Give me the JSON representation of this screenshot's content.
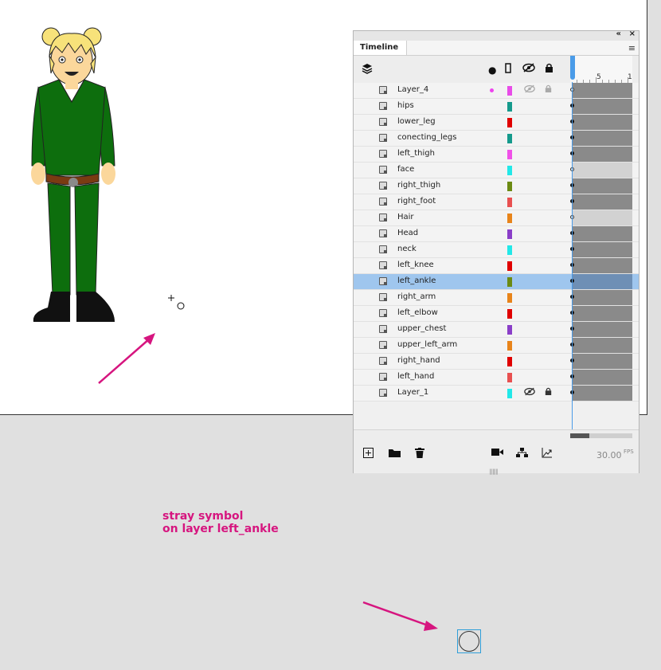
{
  "panel": {
    "title": "Timeline",
    "collapse_icon": "collapse-icon",
    "close_icon": "close-icon",
    "menu_icon": "menu-icon"
  },
  "toolbar": {
    "icons": [
      "layers-icon",
      "active-dot-icon",
      "outline-icon",
      "eye-icon",
      "lock-icon"
    ],
    "ruler_labels": [
      "5",
      "1"
    ]
  },
  "layers": [
    {
      "name": "Layer_4",
      "color": "#e84ce8",
      "active": true,
      "hidden": true,
      "locked": true,
      "keyframe": "hollow",
      "frames": "grey"
    },
    {
      "name": "hips",
      "color": "#159a8c",
      "keyframe": "filled",
      "frames": "grey"
    },
    {
      "name": "lower_leg",
      "color": "#e00000",
      "keyframe": "filled",
      "frames": "grey"
    },
    {
      "name": "conecting_legs",
      "color": "#159a8c",
      "keyframe": "filled",
      "frames": "grey"
    },
    {
      "name": "left_thigh",
      "color": "#f051e8",
      "keyframe": "filled",
      "frames": "grey"
    },
    {
      "name": "face",
      "color": "#22e8e8",
      "keyframe": "hollow",
      "frames": "empty"
    },
    {
      "name": "right_thigh",
      "color": "#6b8a12",
      "keyframe": "filled",
      "frames": "grey"
    },
    {
      "name": "right_foot",
      "color": "#e85050",
      "keyframe": "filled",
      "frames": "grey"
    },
    {
      "name": "Hair",
      "color": "#e8841a",
      "keyframe": "hollow",
      "frames": "empty"
    },
    {
      "name": "Head",
      "color": "#8a3ec8",
      "keyframe": "filled",
      "frames": "grey"
    },
    {
      "name": "neck",
      "color": "#22e8e8",
      "keyframe": "filled",
      "frames": "grey"
    },
    {
      "name": "left_knee",
      "color": "#e00000",
      "keyframe": "filled",
      "frames": "grey"
    },
    {
      "name": "left_ankle",
      "color": "#6b8a12",
      "keyframe": "filled",
      "frames": "grey",
      "selected": true
    },
    {
      "name": "right_arm",
      "color": "#e8841a",
      "keyframe": "filled",
      "frames": "grey"
    },
    {
      "name": "left_elbow",
      "color": "#e00000",
      "keyframe": "filled",
      "frames": "grey"
    },
    {
      "name": "upper_chest",
      "color": "#8a3ec8",
      "keyframe": "filled",
      "frames": "grey"
    },
    {
      "name": "upper_left_arm",
      "color": "#e8841a",
      "keyframe": "filled",
      "frames": "grey"
    },
    {
      "name": "right_hand",
      "color": "#e00000",
      "keyframe": "filled",
      "frames": "grey"
    },
    {
      "name": "left_hand",
      "color": "#e85050",
      "keyframe": "filled",
      "frames": "grey"
    },
    {
      "name": "Layer_1",
      "color": "#22e8e8",
      "hidden": true,
      "locked": true,
      "keyframe": "filled",
      "frames": "grey"
    }
  ],
  "bottom_toolbar": {
    "icons": [
      "new-layer-icon",
      "new-folder-icon",
      "delete-icon",
      "camera-icon",
      "parenting-icon",
      "ease-icon"
    ],
    "fps_value": "30.00",
    "fps_unit": "FPS"
  },
  "annotation": {
    "line1": "stray symbol",
    "line2": "on layer left_ankle",
    "color": "#d6157f"
  },
  "colors": {
    "stage": "#ffffff",
    "pasteboard": "#e0e0e0",
    "selection": "#9fc6ee",
    "playhead": "#4a9be8"
  }
}
